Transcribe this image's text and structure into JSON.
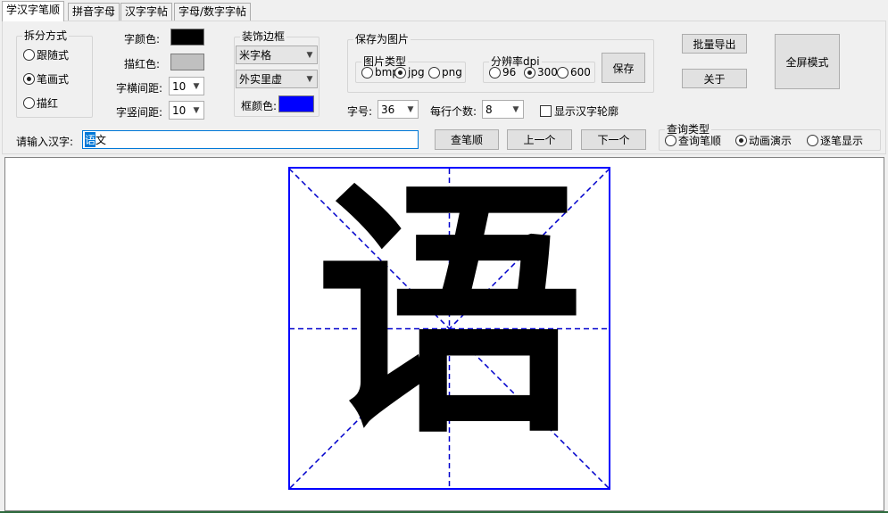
{
  "tabs": [
    {
      "label": "学汉字笔顺",
      "active": true
    },
    {
      "label": "拼音字母",
      "active": false
    },
    {
      "label": "汉字字帖",
      "active": false
    },
    {
      "label": "字母/数字字帖",
      "active": false
    }
  ],
  "split_mode": {
    "legend": "拆分方式",
    "options": [
      "跟随式",
      "笔画式",
      "描红"
    ],
    "selected": "笔画式"
  },
  "colors": {
    "char_color_label": "字颜色:",
    "char_color": "#000000",
    "trace_color_label": "描红色:",
    "trace_color": "#c0c0c0",
    "frame_color": "#0000ff",
    "canvas_grid": "#0000cc"
  },
  "spacing": {
    "h_label": "字横间距:",
    "h_value": "10",
    "v_label": "字竖间距:",
    "v_value": "10"
  },
  "frame": {
    "legend": "装饰边框",
    "grid_style": "米字格",
    "line_style": "外实里虚",
    "color_label": "框颜色:"
  },
  "save_image": {
    "legend": "保存为图片",
    "type_legend": "图片类型",
    "types": [
      "bmp",
      "jpg",
      "png"
    ],
    "type_selected": "jpg",
    "dpi_legend": "分辨率dpi",
    "dpis": [
      "96",
      "300",
      "600"
    ],
    "dpi_selected": "300",
    "save_button": "保存"
  },
  "font_size": {
    "label": "字号:",
    "value": "36"
  },
  "per_row": {
    "label": "每行个数:",
    "value": "8"
  },
  "outline": {
    "label": "显示汉字轮廓",
    "checked": false
  },
  "buttons": {
    "batch_export": "批量导出",
    "about": "关于",
    "fullscreen": "全屏模式",
    "query": "查笔顺",
    "prev": "上一个",
    "next": "下一个"
  },
  "input": {
    "label": "请输入汉字:",
    "selected_part": "语",
    "rest": "文"
  },
  "query_type": {
    "legend": "查询类型",
    "options": [
      "查询笔顺",
      "动画演示",
      "逐笔显示"
    ],
    "selected": "动画演示"
  },
  "display": {
    "character": "语"
  }
}
